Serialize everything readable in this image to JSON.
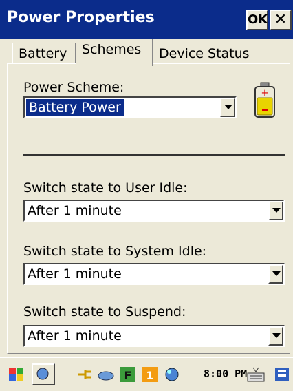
{
  "window": {
    "title": "Power Properties",
    "ok_label": "OK",
    "close_glyph": "✕"
  },
  "tabs": [
    {
      "label": "Battery",
      "active": false
    },
    {
      "label": "Schemes",
      "active": true
    },
    {
      "label": "Device Status",
      "active": false
    }
  ],
  "schemes": {
    "power_scheme_label": "Power Scheme:",
    "power_scheme_value": "Battery Power",
    "battery_icon": "battery-icon"
  },
  "states": [
    {
      "label": "Switch state to User Idle:",
      "value": "After 1 minute"
    },
    {
      "label": "Switch state to System Idle:",
      "value": "After 1 minute"
    },
    {
      "label": "Switch state to Suspend:",
      "value": "After 1 minute"
    }
  ],
  "taskbar": {
    "clock": "8:00 PM",
    "icons": [
      "start-icon",
      "desktop-icon",
      "power-icon",
      "network-icon",
      "f-badge-icon",
      "one-badge-icon",
      "sync-icon",
      "keyboard-icon",
      "app-icon"
    ]
  },
  "colors": {
    "titlebar": "#0B2C8B",
    "selection": "#0B2C8B",
    "face": "#ECE9D8"
  }
}
